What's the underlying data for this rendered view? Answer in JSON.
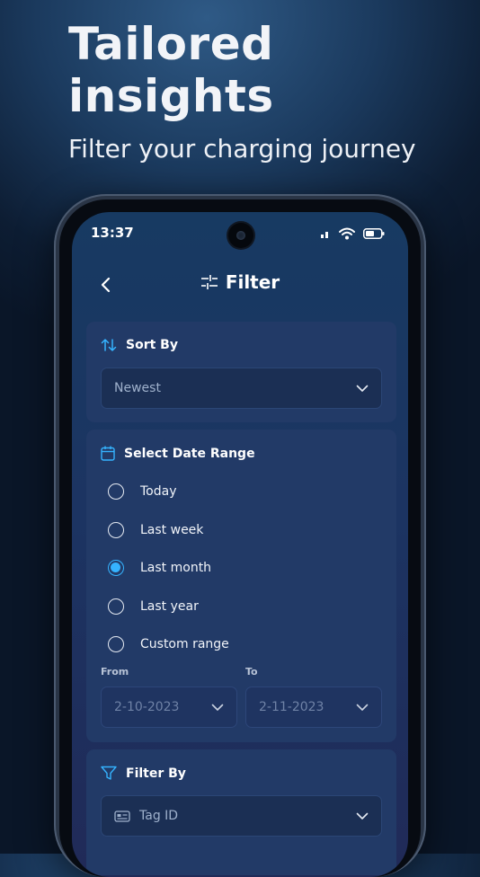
{
  "promo": {
    "title_line1": "Tailored",
    "title_line2": "insights",
    "subtitle": "Filter your charging journey"
  },
  "status_bar": {
    "time": "13:37"
  },
  "nav": {
    "title": "Filter"
  },
  "sort_by": {
    "title": "Sort By",
    "selected": "Newest"
  },
  "date_range": {
    "title": "Select Date Range",
    "options": [
      {
        "label": "Today",
        "checked": false
      },
      {
        "label": "Last week",
        "checked": false
      },
      {
        "label": "Last month",
        "checked": true
      },
      {
        "label": "Last year",
        "checked": false
      },
      {
        "label": "Custom range",
        "checked": false
      }
    ],
    "from_label": "From",
    "to_label": "To",
    "from_value": "2-10-2023",
    "to_value": "2-11-2023"
  },
  "filter_by": {
    "title": "Filter By",
    "selected": "Tag ID"
  },
  "colors": {
    "accent": "#35b3ff",
    "card": "#223a67",
    "field": "#1b2f54"
  }
}
